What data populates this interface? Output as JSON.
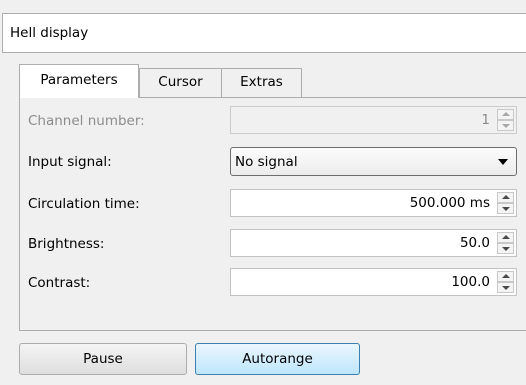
{
  "window": {
    "title": "Hell display"
  },
  "tabs": [
    {
      "label": "Parameters",
      "active": true
    },
    {
      "label": "Cursor",
      "active": false
    },
    {
      "label": "Extras",
      "active": false
    }
  ],
  "parameters": {
    "channel_number": {
      "label": "Channel number:",
      "value": "1",
      "enabled": false
    },
    "input_signal": {
      "label": "Input signal:",
      "value": "No signal"
    },
    "circulation_time": {
      "label": "Circulation time:",
      "value": "500.000 ms"
    },
    "brightness": {
      "label": "Brightness:",
      "value": "50.0"
    },
    "contrast": {
      "label": "Contrast:",
      "value": "100.0"
    }
  },
  "buttons": {
    "pause": "Pause",
    "autorange": "Autorange"
  },
  "icons": {
    "spin_up": "chevron-up-icon",
    "spin_down": "chevron-down-icon",
    "dropdown": "caret-down-icon"
  },
  "colors": {
    "accent_button_border": "#3c7fb1",
    "accent_button_fill": "#bee6fd",
    "disabled_text": "#8c8c8c"
  }
}
